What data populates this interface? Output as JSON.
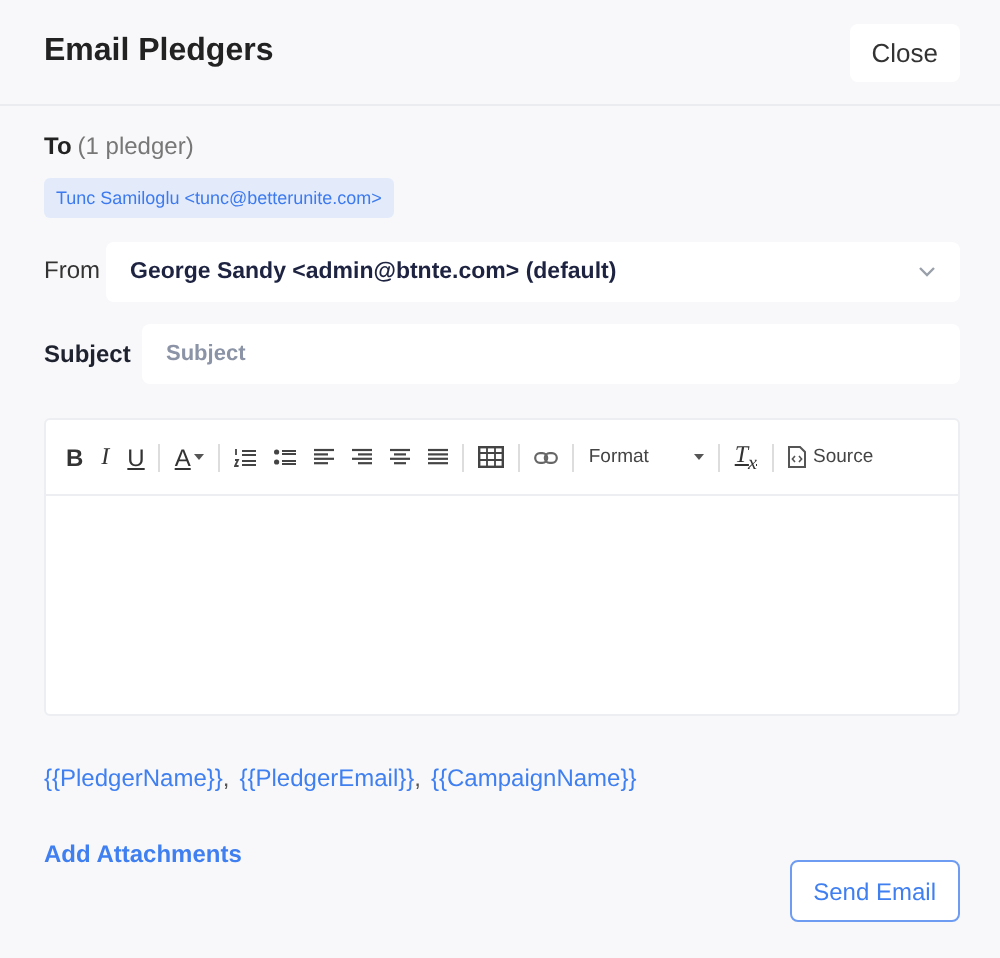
{
  "header": {
    "title": "Email Pledgers",
    "close_button": "Close"
  },
  "to": {
    "label": "To",
    "count": "(1 pledger)",
    "recipients": [
      "Tunc Samiloglu <tunc@betterunite.com>"
    ]
  },
  "from": {
    "label": "From",
    "value": "George Sandy <admin@btnte.com> (default)"
  },
  "subject": {
    "label": "Subject",
    "placeholder": "Subject"
  },
  "toolbar": [
    {
      "kind": "bold",
      "text": "B"
    },
    {
      "kind": "italic",
      "text": "I"
    },
    {
      "kind": "underline",
      "text": "U"
    },
    {
      "kind": "separator"
    },
    {
      "kind": "color",
      "text": "A"
    },
    {
      "kind": "separator"
    },
    {
      "kind": "ordered-list"
    },
    {
      "kind": "bullet-list"
    },
    {
      "kind": "align-left"
    },
    {
      "kind": "align-right"
    },
    {
      "kind": "align-center"
    },
    {
      "kind": "justify"
    },
    {
      "kind": "separator"
    },
    {
      "kind": "table"
    },
    {
      "kind": "separator"
    },
    {
      "kind": "link"
    },
    {
      "kind": "separator"
    },
    {
      "kind": "format",
      "text": "Format"
    },
    {
      "kind": "separator"
    },
    {
      "kind": "clear",
      "text": "T$_{x}$"
    },
    {
      "kind": "separator"
    },
    {
      "kind": "source",
      "text": "Source"
    }
  ],
  "merge_tags": {
    "tags": [
      "{{PledgerName}}",
      "{{PledgerEmail}}",
      "{{CampaignName}}"
    ],
    "separator": ","
  },
  "add_attachments": "Add Attachments",
  "send_button": "Send Email"
}
